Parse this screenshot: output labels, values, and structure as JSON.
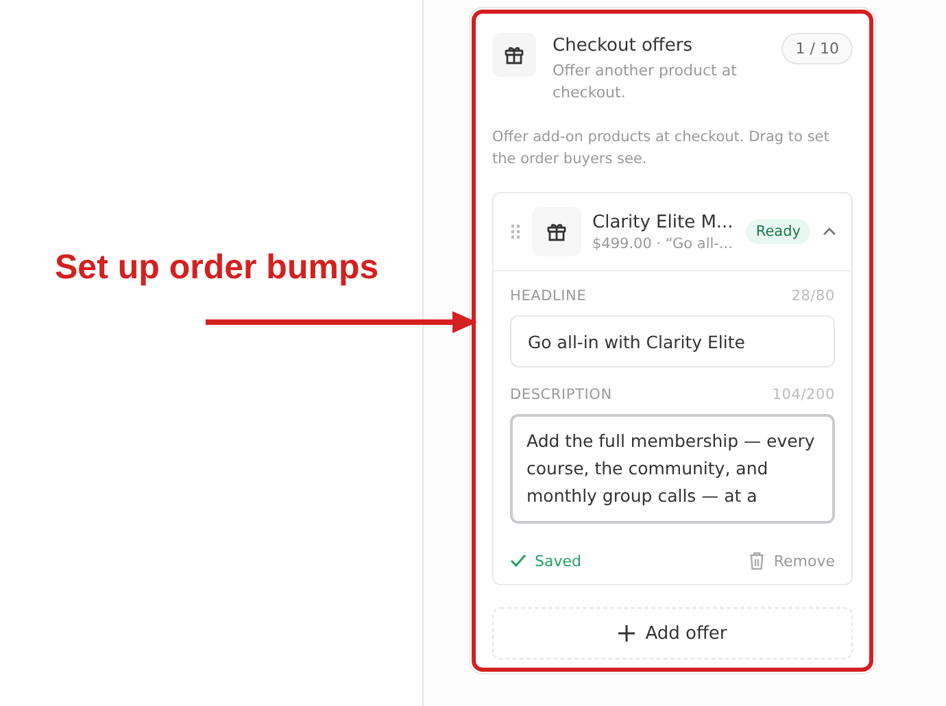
{
  "annotation": {
    "label": "Set up order bumps"
  },
  "section": {
    "title": "Checkout offers",
    "subtitle": "Offer another product at checkout.",
    "count": "1 / 10",
    "description": "Offer add-on products at checkout. Drag to set the order buyers see."
  },
  "offers": [
    {
      "name": "Clarity Elite M...",
      "meta": "$499.00 · “Go all-...",
      "status": "Ready",
      "expanded": true,
      "headline": {
        "label": "HEADLINE",
        "counter": "28/80",
        "value": "Go all-in with Clarity Elite"
      },
      "body": {
        "label": "DESCRIPTION",
        "counter": "104/200",
        "value": "Add the full membership — every course, the community, and monthly group calls — at a"
      },
      "saved": "Saved",
      "remove": "Remove"
    }
  ],
  "add_button": {
    "label": "Add offer"
  }
}
